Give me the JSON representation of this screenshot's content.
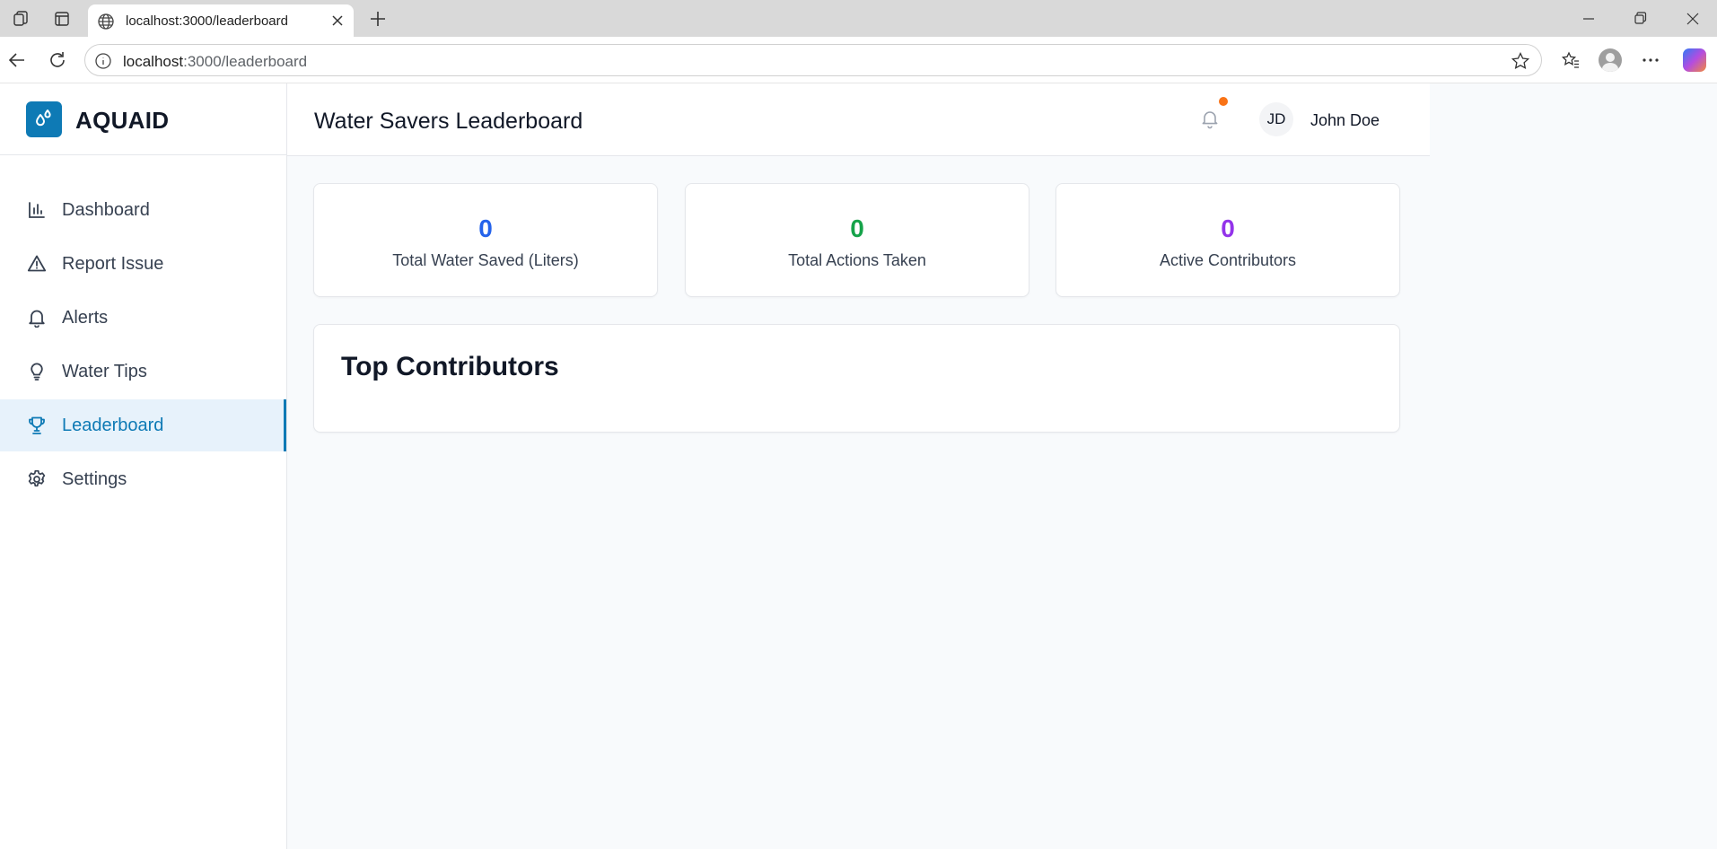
{
  "browser": {
    "tab_title": "localhost:3000/leaderboard",
    "url_host": "localhost",
    "url_path": ":3000/leaderboard"
  },
  "app": {
    "brand": "AQUAID",
    "nav": [
      {
        "label": "Dashboard",
        "icon": "bar-chart-icon"
      },
      {
        "label": "Report Issue",
        "icon": "warning-triangle-icon"
      },
      {
        "label": "Alerts",
        "icon": "bell-icon"
      },
      {
        "label": "Water Tips",
        "icon": "lightbulb-icon"
      },
      {
        "label": "Leaderboard",
        "icon": "trophy-icon",
        "active": true
      },
      {
        "label": "Settings",
        "icon": "gear-icon"
      }
    ]
  },
  "header": {
    "title": "Water Savers Leaderboard",
    "user_initials": "JD",
    "user_name": "John Doe"
  },
  "stats": [
    {
      "value": "0",
      "label": "Total Water Saved (Liters)",
      "color": "#2563eb"
    },
    {
      "value": "0",
      "label": "Total Actions Taken",
      "color": "#16a34a"
    },
    {
      "value": "0",
      "label": "Active Contributors",
      "color": "#9333ea"
    }
  ],
  "contributors": {
    "title": "Top Contributors"
  },
  "colors": {
    "accent": "#0e7ab5",
    "notification_dot": "#f97316"
  }
}
